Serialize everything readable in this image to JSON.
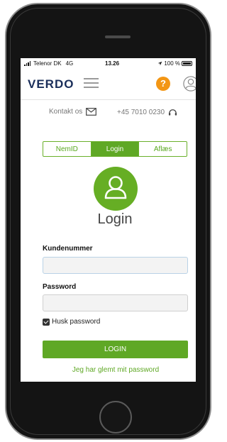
{
  "statusbar": {
    "carrier": "Telenor DK",
    "network": "4G",
    "time": "13.26",
    "battery": "100 %"
  },
  "navbar": {
    "logo": "VERDO",
    "help_label": "?"
  },
  "contact": {
    "contact_label": "Kontakt os",
    "phone_label": "+45 7010 0230"
  },
  "tabs": [
    {
      "label": "NemID",
      "active": false
    },
    {
      "label": "Login",
      "active": true
    },
    {
      "label": "Aflæs",
      "active": false
    }
  ],
  "login": {
    "heading": "Login",
    "customer_number_label": "Kundenummer",
    "customer_number_value": "",
    "password_label": "Password",
    "password_value": "",
    "remember_label": "Husk password",
    "remember_checked": true,
    "login_button": "LOGIN",
    "forgot_link": "Jeg har glemt mit password"
  },
  "colors": {
    "brand_green": "#5fa825",
    "help_orange": "#f39614",
    "logo_navy": "#1a2e5a"
  },
  "icons": [
    "menu-icon",
    "help-icon",
    "user-icon",
    "mail-icon",
    "headset-icon",
    "user-avatar-icon",
    "checkbox-check-icon",
    "signal-icon",
    "location-arrow-icon",
    "battery-icon"
  ]
}
